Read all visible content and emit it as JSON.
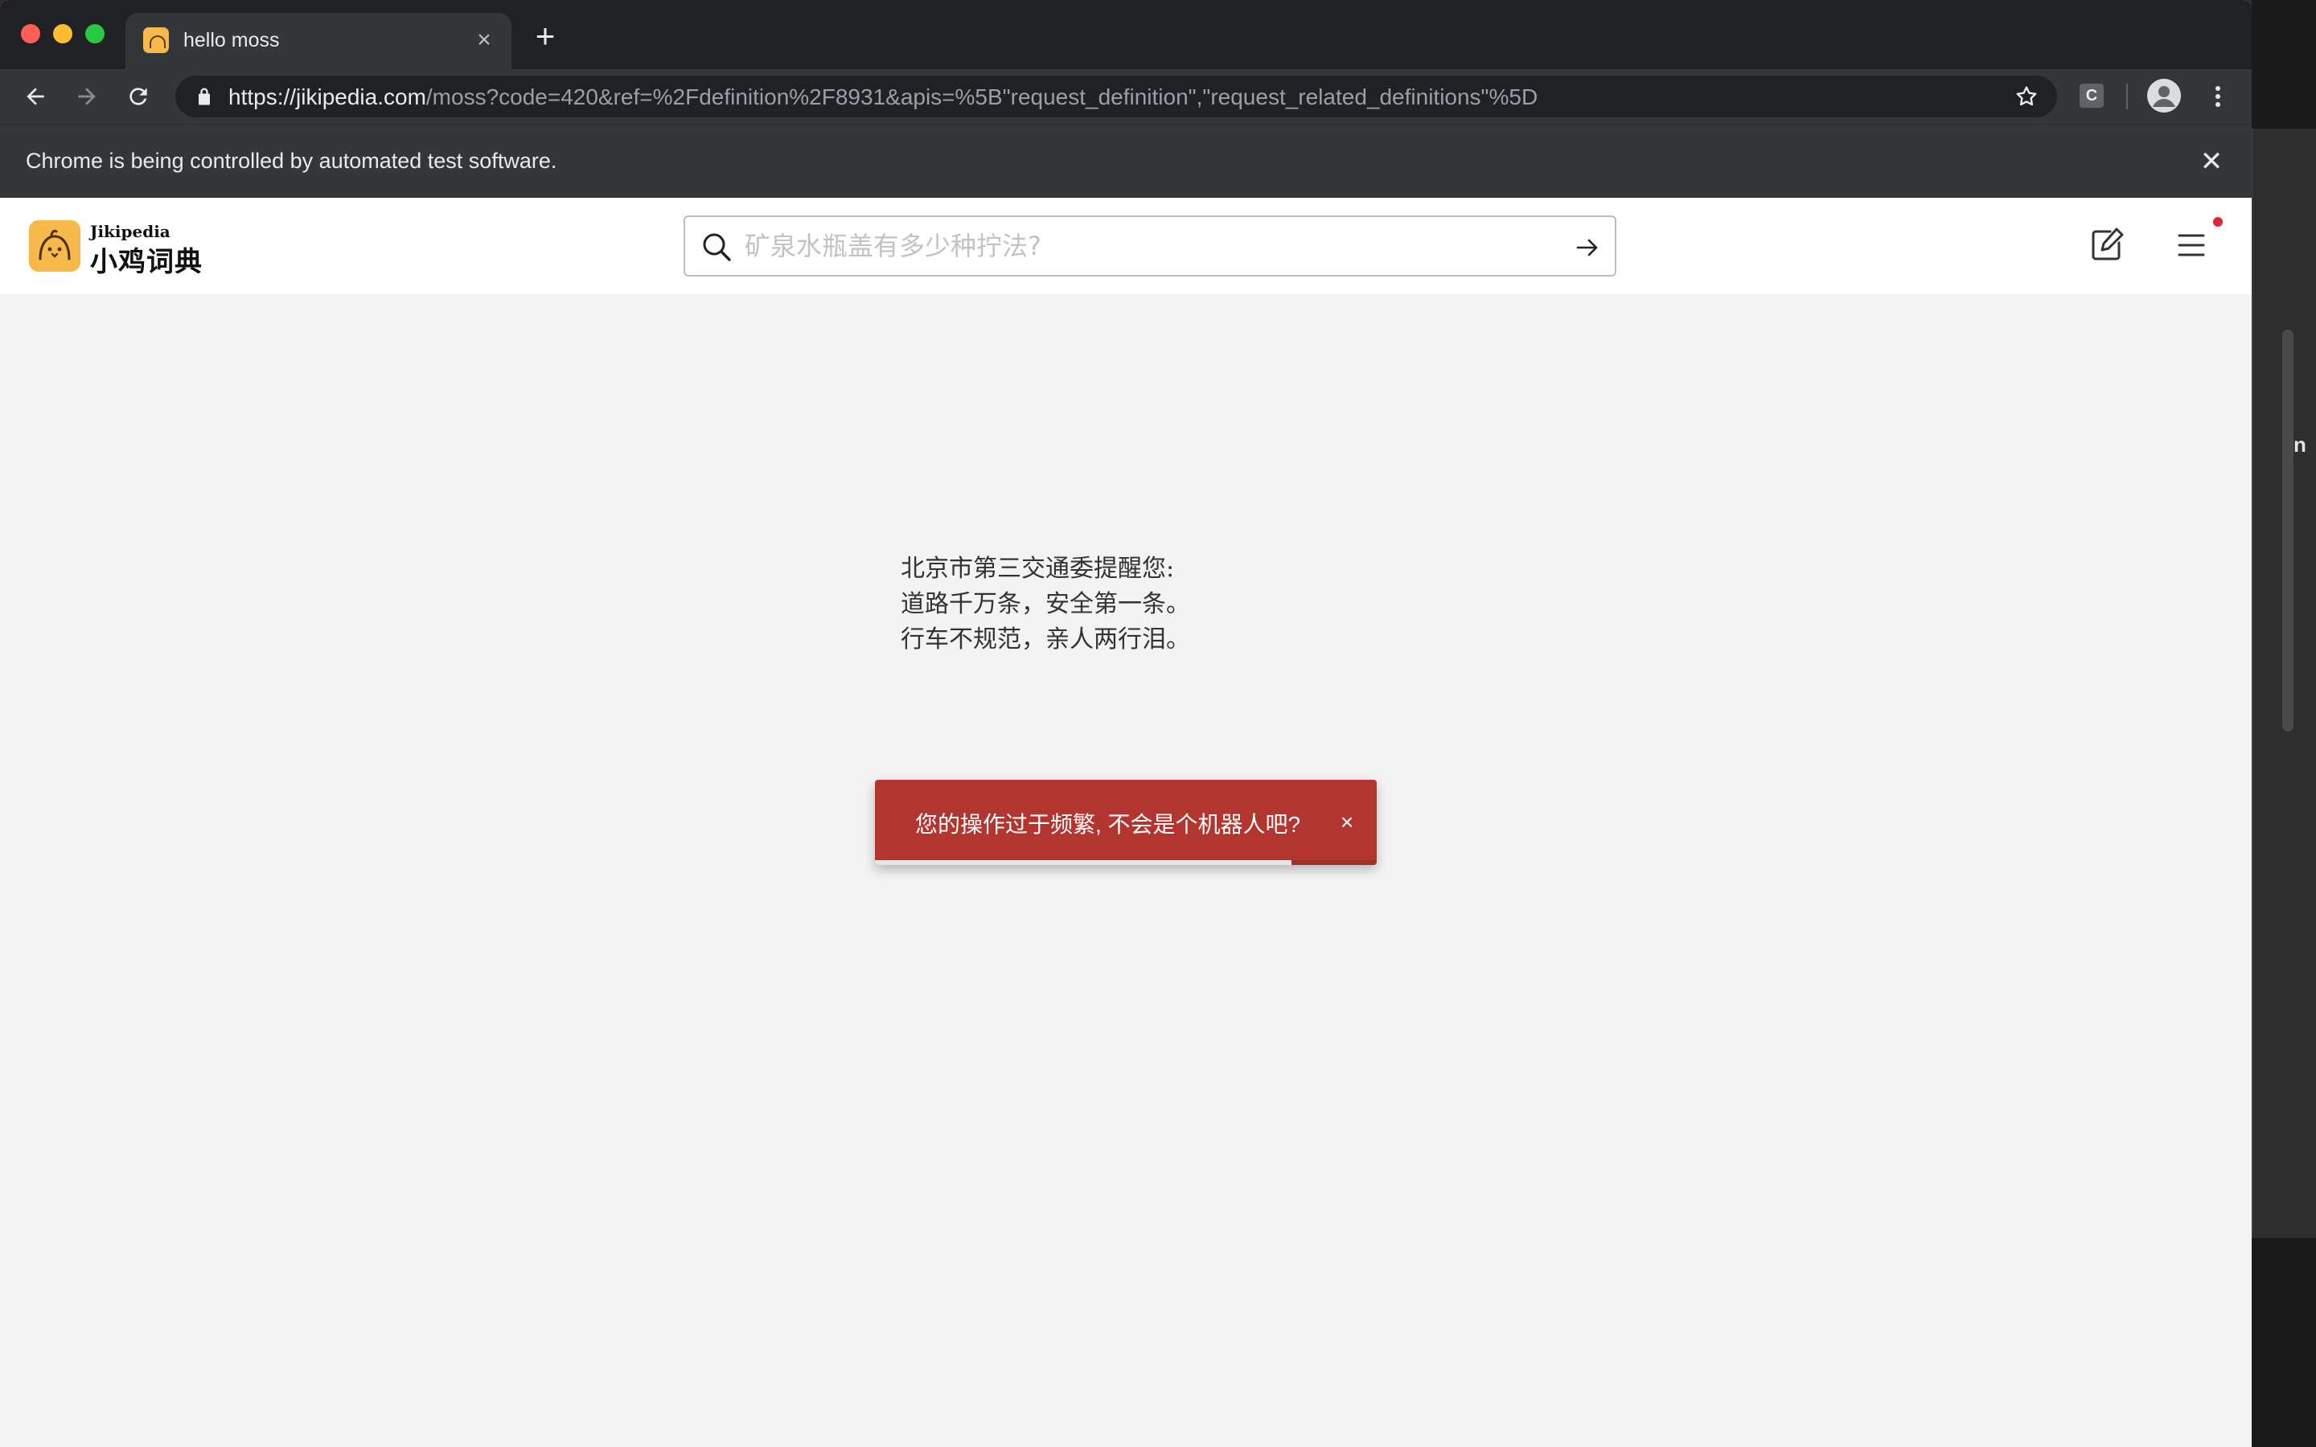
{
  "browser": {
    "tab_title": "hello moss",
    "tab_close": "×",
    "new_tab": "+",
    "url_host": "https://jikipedia.com",
    "url_path": "/moss?code=420&ref=%2Fdefinition%2F8931&apis=%5B\"request_definition\",\"request_related_definitions\"%5D",
    "extension_label": "C",
    "infobar_message": "Chrome is being controlled by automated test software.",
    "infobar_close": "✕"
  },
  "site": {
    "brand_en": "Jikipedia",
    "brand_cn": "小鸡词典",
    "search_placeholder": "矿泉水瓶盖有多少种拧法?",
    "accent_color": "#f6b94a"
  },
  "main": {
    "poem_lines": [
      "北京市第三交通委提醒您:",
      "道路千万条，安全第一条。",
      "行车不规范，亲人两行泪。"
    ]
  },
  "toast": {
    "message": "您的操作过于频繁, 不会是个机器人吧?",
    "close": "×",
    "color": "#b23530",
    "progress_fraction": 0.83
  },
  "backdrop": {
    "peek_text": "n"
  }
}
